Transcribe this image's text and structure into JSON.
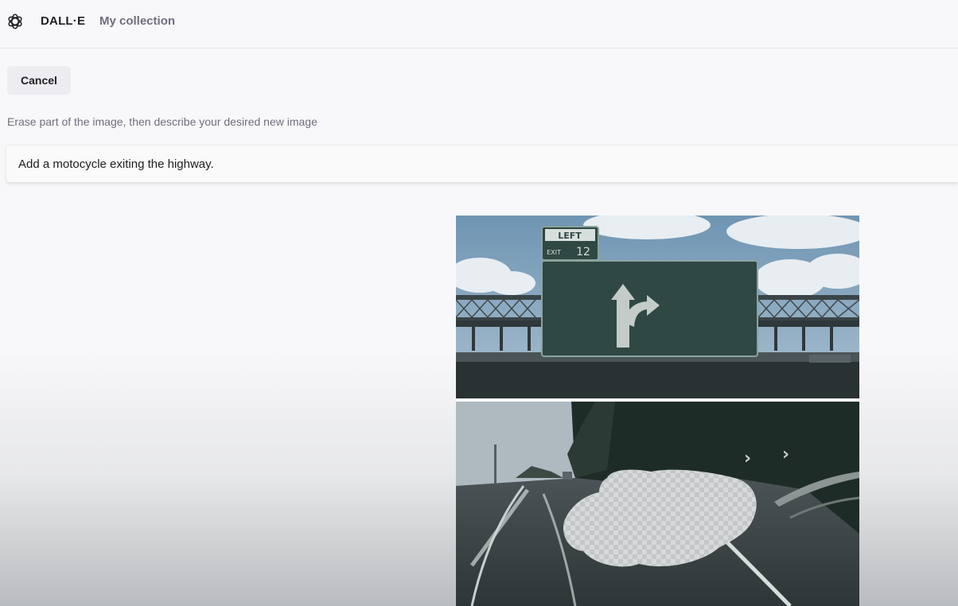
{
  "header": {
    "brand": "DALL·E",
    "nav_collection": "My collection",
    "logo_icon": "openai-logo-icon"
  },
  "editor": {
    "cancel_label": "Cancel",
    "instruction": "Erase part of the image, then describe your desired new image",
    "prompt_value": "Add a motocycle exiting the highway."
  },
  "image": {
    "sign_top_label": "LEFT",
    "sign_exit_label": "EXIT",
    "sign_exit_number": "12",
    "sign_arrow_icon": "split-arrow-icon",
    "erased_region": "transparent-checkerboard"
  }
}
